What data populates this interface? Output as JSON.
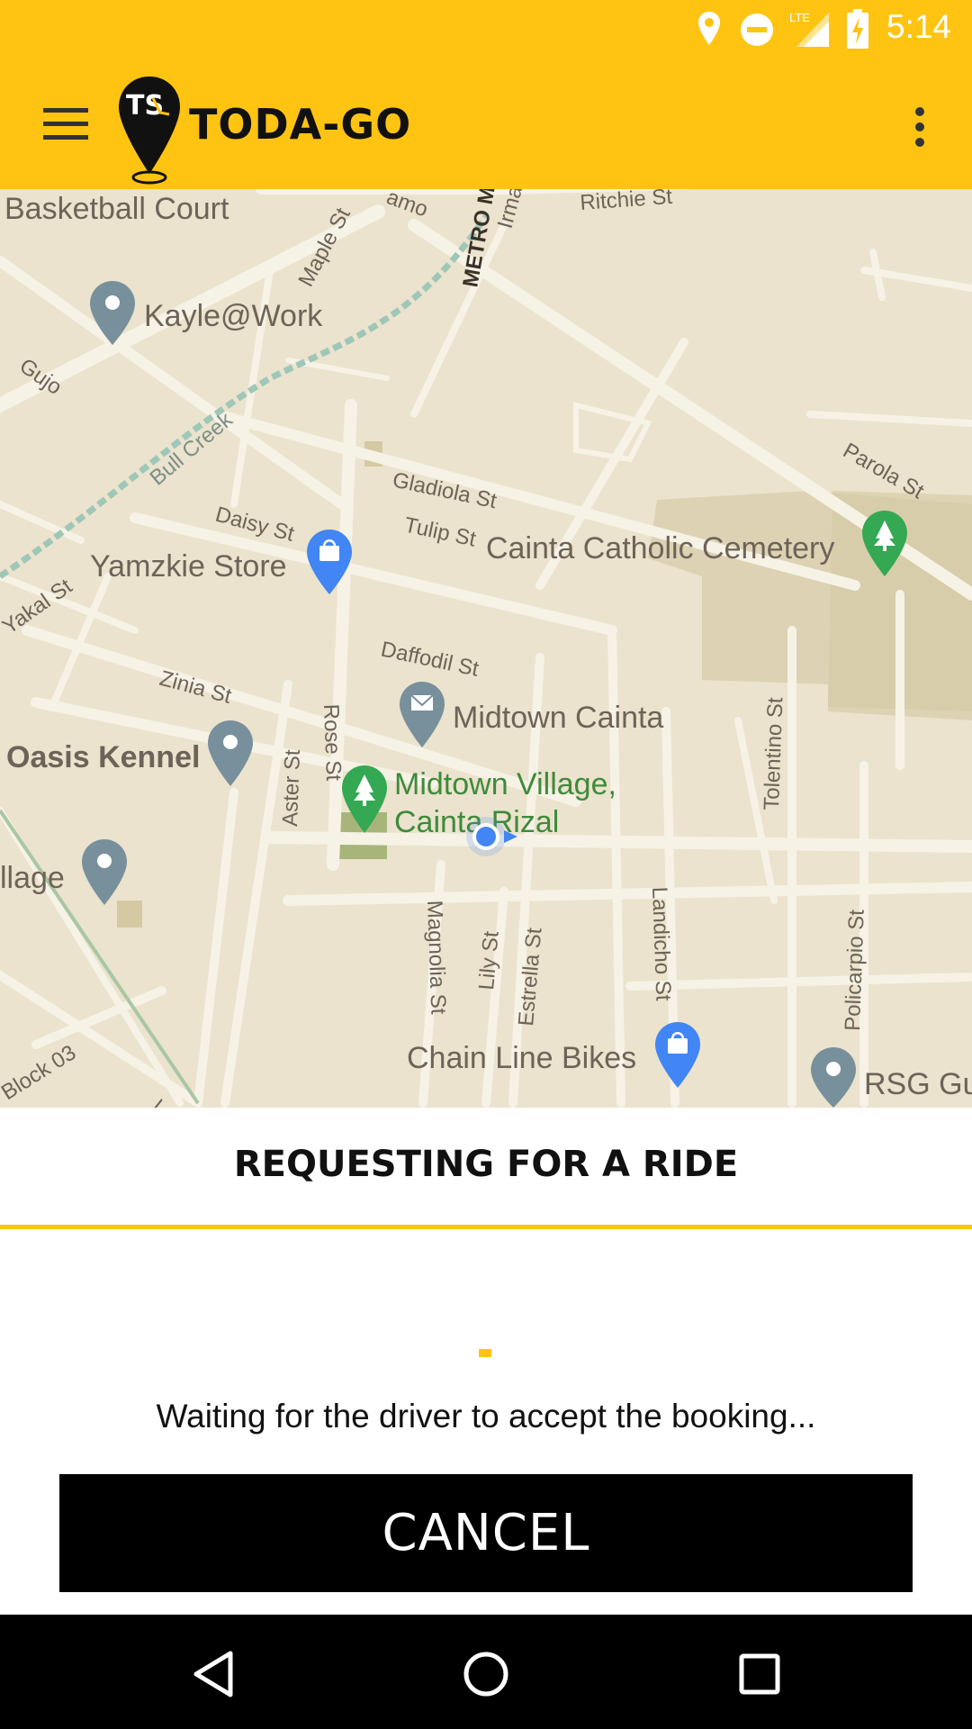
{
  "status_bar": {
    "network_label": "LTE",
    "time": "5:14"
  },
  "app_bar": {
    "brand": "TODA-GO",
    "logo_letters": "TS"
  },
  "map": {
    "labels": {
      "basketball_court": "Basketball Court",
      "ritchie_st": "Ritchie St",
      "metro_manila": "METRO MAN",
      "irma": "Irma",
      "amo": "amo",
      "maple_st": "Maple St",
      "kayle_at_work": "Kayle@Work",
      "gujo": "Gujo",
      "bull_creek": "Bull Creek",
      "parola_st": "Parola St",
      "gladiola_st": "Gladiola St",
      "daisy_st": "Daisy St",
      "tulip_st": "Tulip St",
      "cainta_catholic_cemetery": "Cainta Catholic Cemetery",
      "yamzkie_store": "Yamzkie Store",
      "yakal_st": "Yakal St",
      "daffodil_st": "Daffodil St",
      "zinia_st": "Zinia St",
      "midtown_cainta": "Midtown Cainta",
      "tolentino_st": "Tolentino St",
      "oasis_kennel": "Oasis Kennel",
      "rose_st": "Rose St",
      "aster_st": "Aster St",
      "midtown_village_1": "Midtown Village,",
      "midtown_village_2": "Cainta Rizal",
      "village": "llage",
      "magnolia_st": "Magnolia St",
      "lily_st": "Lily St",
      "estrella_st": "Estrella St",
      "landicho_st": "Landicho St",
      "policarpio_st": "Policarpio St",
      "block_03": "Block 03",
      "chain_line_bikes": "Chain Line Bikes",
      "rsg": "RSG Gu",
      "vi": "Vi"
    }
  },
  "sheet": {
    "title": "REQUESTING FOR A RIDE",
    "waiting_text": "Waiting for the driver to accept the booking...",
    "cancel_label": "CANCEL"
  },
  "colors": {
    "accent": "#FFC312",
    "map_background": "#EBE3CD",
    "park_green": "#34A853",
    "poi_gray": "#78909C",
    "shopping_blue": "#4285F4"
  }
}
